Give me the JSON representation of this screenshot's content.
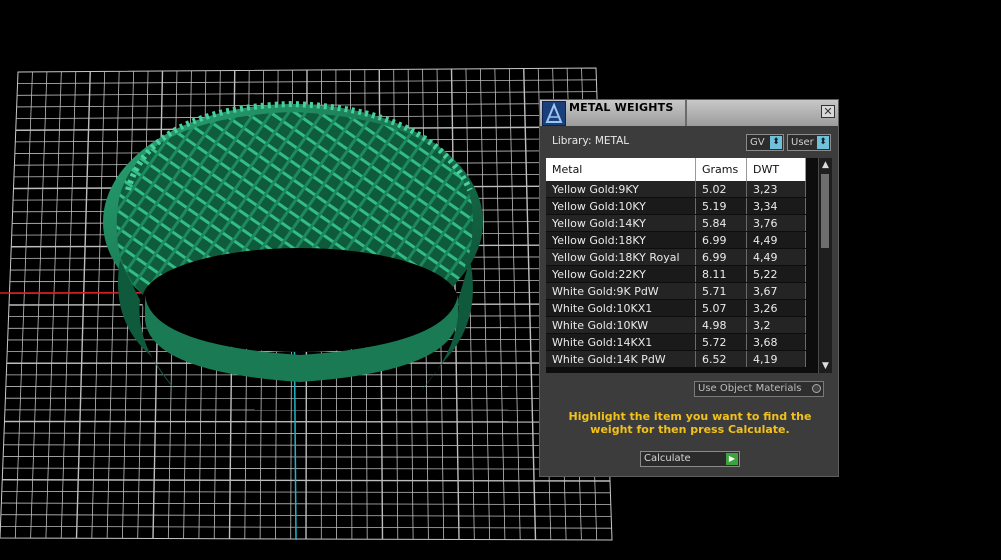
{
  "panel": {
    "title": "METAL WEIGHTS",
    "library_label": "Library: METAL",
    "gv_button": "GV",
    "user_button": "User",
    "close_glyph": "✕",
    "use_object_materials": "Use Object Materials",
    "hint": "Highlight the item you want to find the weight for then press Calculate.",
    "calculate_label": "Calculate",
    "accent_color": "#f2c21b"
  },
  "table": {
    "headers": [
      "Metal",
      "Grams",
      "DWT"
    ],
    "rows": [
      [
        "Yellow Gold:9KY",
        "5.02",
        "3,23"
      ],
      [
        "Yellow Gold:10KY",
        "5.19",
        "3,34"
      ],
      [
        "Yellow Gold:14KY",
        "5.84",
        "3,76"
      ],
      [
        "Yellow Gold:18KY",
        "6.99",
        "4,49"
      ],
      [
        "Yellow Gold:18KY Royal",
        "6.99",
        "4,49"
      ],
      [
        "Yellow Gold:22KY",
        "8.11",
        "5,22"
      ],
      [
        "White Gold:9K PdW",
        "5.71",
        "3,67"
      ],
      [
        "White Gold:10KX1",
        "5.07",
        "3,26"
      ],
      [
        "White Gold:10KW",
        "4.98",
        "3,2"
      ],
      [
        "White Gold:14KX1",
        "5.72",
        "3,68"
      ],
      [
        "White Gold:14K PdW",
        "6.52",
        "4,19"
      ]
    ]
  },
  "viewport": {
    "ring_color": "#1f8a5e",
    "grid_color": "#d8d8d8",
    "x_axis_color": "#d21f1f",
    "y_axis_color": "#1fb3c8"
  }
}
